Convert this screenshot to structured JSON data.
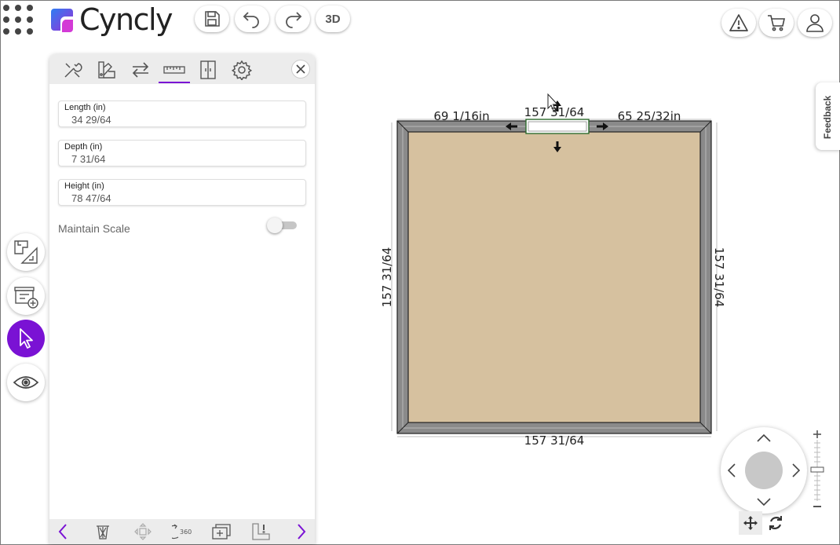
{
  "brand": {
    "name": "Cyncly",
    "color": "#7a12d4"
  },
  "toolbar": {
    "save_icon": "save-icon",
    "undo_icon": "undo-icon",
    "redo_icon": "redo-icon",
    "view_3d_label": "3D",
    "warning_icon": "warning-icon",
    "cart_icon": "cart-icon",
    "user_icon": "user-icon"
  },
  "left_rail": [
    {
      "name": "floor-plan-tool",
      "icon": "floor-plan-icon",
      "active": false
    },
    {
      "name": "add-cabinet-tool",
      "icon": "add-cabinet-icon",
      "active": false
    },
    {
      "name": "select-tool",
      "icon": "pointer-icon",
      "active": true
    },
    {
      "name": "view-tool",
      "icon": "eye-icon",
      "active": false
    }
  ],
  "panel": {
    "tabs": [
      "tools-icon",
      "materials-icon",
      "swap-icon",
      "ruler-icon",
      "door-icon",
      "settings-icon"
    ],
    "active_tab": 3,
    "fields": [
      {
        "label": "Length (in)",
        "value": "34 29/64"
      },
      {
        "label": "Depth (in)",
        "value": "7 31/64"
      },
      {
        "label": "Height (in)",
        "value": "78 47/64"
      }
    ],
    "maintain_scale": {
      "label": "Maintain Scale",
      "on": false
    },
    "footer": [
      "prev-icon",
      "trash-icon",
      "move-icon",
      "rotate-360-icon",
      "duplicate-icon",
      "clearance-icon",
      "next-icon"
    ],
    "footer_360_label": "360°"
  },
  "feedback_label": "Feedback",
  "plan": {
    "top_left": "69 1/16in",
    "top_center": "157 31/64",
    "top_right": "65 25/32in",
    "left": "157 31/64",
    "right": "157 31/64",
    "bottom": "157 31/64",
    "floor_color": "#d6c19f",
    "wall_color": "#8a8a8a"
  }
}
